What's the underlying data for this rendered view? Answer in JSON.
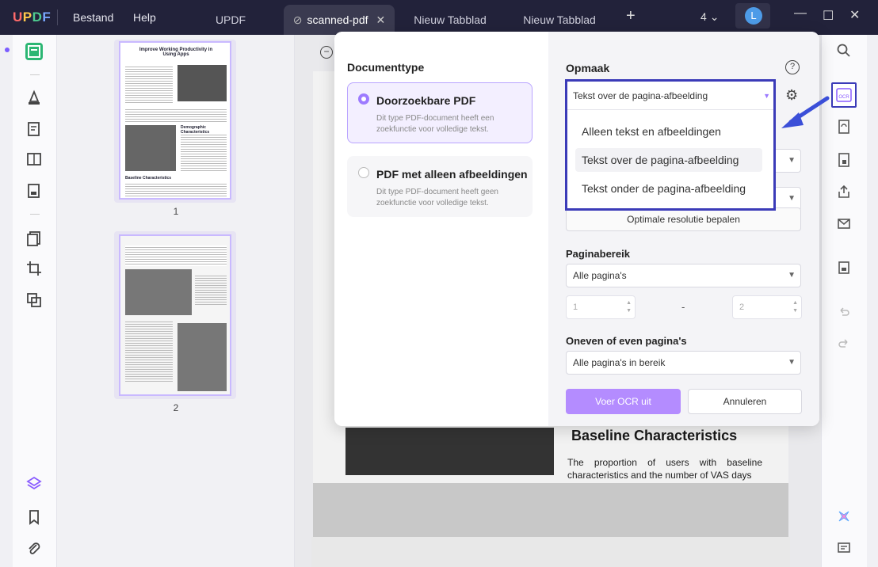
{
  "app": {
    "logo": "UPDF",
    "menu": [
      "Bestand",
      "Help"
    ],
    "tabs": [
      {
        "label": "UPDF",
        "active": false
      },
      {
        "label": "scanned-pdf",
        "active": true
      },
      {
        "label": "Nieuw Tabblad",
        "active": false
      },
      {
        "label": "Nieuw Tabblad",
        "active": false
      }
    ],
    "window_count": "4",
    "user_initial": "L"
  },
  "thumbnails": {
    "pages": [
      {
        "number": "1",
        "heading": "Improve Working Productivity in Using Apps",
        "subheading": "Demographic Characteristics",
        "subheading2": "Baseline Characteristics"
      },
      {
        "number": "2"
      }
    ]
  },
  "document": {
    "section_title": "Baseline Characteristics",
    "section_text": "The proportion of users with baseline characteristics and the number of VAS days"
  },
  "ocr_dialog": {
    "doc_type_title": "Documenttype",
    "options": [
      {
        "title": "Doorzoekbare PDF",
        "desc": "Dit type PDF-document heeft een zoekfunctie voor volledige tekst.",
        "selected": true
      },
      {
        "title": "PDF met alleen afbeeldingen",
        "desc": "Dit type PDF-document heeft geen zoekfunctie voor volledige tekst.",
        "selected": false
      }
    ],
    "layout_title": "Opmaak",
    "layout_value": "Tekst over de pagina-afbeelding",
    "layout_options": [
      "Alleen tekst en afbeeldingen",
      "Tekst over de pagina-afbeelding",
      "Tekst onder de pagina-afbeelding"
    ],
    "resolution_button": "Optimale resolutie bepalen",
    "page_range_title": "Paginabereik",
    "page_range_value": "Alle pagina's",
    "range_from": "1",
    "range_dash": "-",
    "range_to": "2",
    "odd_even_title": "Oneven of even pagina's",
    "odd_even_value": "Alle pagina's in bereik",
    "run_button": "Voer OCR uit",
    "cancel_button": "Annuleren"
  },
  "colors": {
    "accent": "#9d7bff",
    "highlight_frame": "#3b3bb8"
  }
}
